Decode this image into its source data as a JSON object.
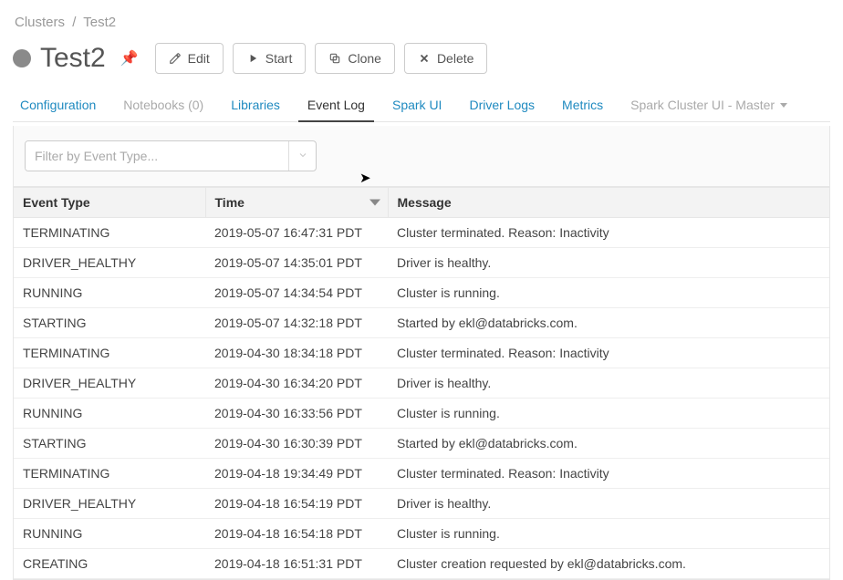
{
  "breadcrumb": {
    "root": "Clusters",
    "current": "Test2"
  },
  "title": "Test2",
  "status": "inactive",
  "buttons": {
    "edit": "Edit",
    "start": "Start",
    "clone": "Clone",
    "delete": "Delete"
  },
  "tabs": [
    {
      "id": "configuration",
      "label": "Configuration",
      "style": "link"
    },
    {
      "id": "notebooks",
      "label": "Notebooks (0)",
      "style": "disabled"
    },
    {
      "id": "libraries",
      "label": "Libraries",
      "style": "link"
    },
    {
      "id": "event-log",
      "label": "Event Log",
      "style": "active"
    },
    {
      "id": "spark-ui",
      "label": "Spark UI",
      "style": "link"
    },
    {
      "id": "driver-logs",
      "label": "Driver Logs",
      "style": "link"
    },
    {
      "id": "metrics",
      "label": "Metrics",
      "style": "link"
    },
    {
      "id": "spark-cluster-ui",
      "label": "Spark Cluster UI - Master",
      "style": "disabled",
      "dropdown": true
    }
  ],
  "filter": {
    "placeholder": "Filter by Event Type...",
    "value": ""
  },
  "columns": {
    "eventType": "Event Type",
    "time": "Time",
    "message": "Message"
  },
  "sort": {
    "column": "time",
    "direction": "desc"
  },
  "events": [
    {
      "type": "TERMINATING",
      "time": "2019-05-07 16:47:31 PDT",
      "message": "Cluster terminated. Reason: Inactivity"
    },
    {
      "type": "DRIVER_HEALTHY",
      "time": "2019-05-07 14:35:01 PDT",
      "message": "Driver is healthy."
    },
    {
      "type": "RUNNING",
      "time": "2019-05-07 14:34:54 PDT",
      "message": "Cluster is running."
    },
    {
      "type": "STARTING",
      "time": "2019-05-07 14:32:18 PDT",
      "message": "Started by ekl@databricks.com."
    },
    {
      "type": "TERMINATING",
      "time": "2019-04-30 18:34:18 PDT",
      "message": "Cluster terminated. Reason: Inactivity"
    },
    {
      "type": "DRIVER_HEALTHY",
      "time": "2019-04-30 16:34:20 PDT",
      "message": "Driver is healthy."
    },
    {
      "type": "RUNNING",
      "time": "2019-04-30 16:33:56 PDT",
      "message": "Cluster is running."
    },
    {
      "type": "STARTING",
      "time": "2019-04-30 16:30:39 PDT",
      "message": "Started by ekl@databricks.com."
    },
    {
      "type": "TERMINATING",
      "time": "2019-04-18 19:34:49 PDT",
      "message": "Cluster terminated. Reason: Inactivity"
    },
    {
      "type": "DRIVER_HEALTHY",
      "time": "2019-04-18 16:54:19 PDT",
      "message": "Driver is healthy."
    },
    {
      "type": "RUNNING",
      "time": "2019-04-18 16:54:18 PDT",
      "message": "Cluster is running."
    },
    {
      "type": "CREATING",
      "time": "2019-04-18 16:51:31 PDT",
      "message": "Cluster creation requested by ekl@databricks.com."
    }
  ]
}
